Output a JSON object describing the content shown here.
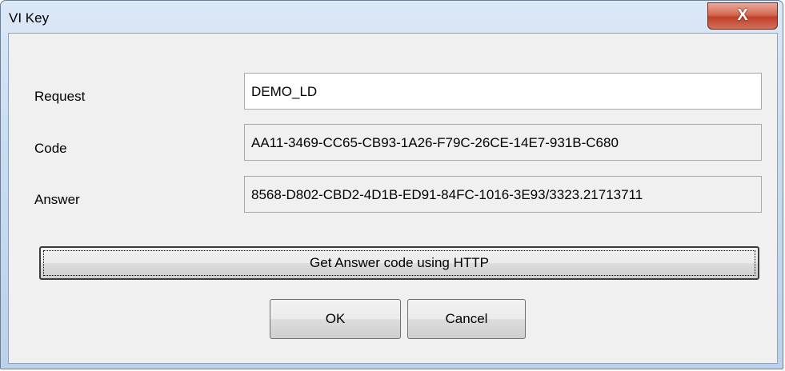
{
  "window": {
    "title": "VI Key",
    "close_glyph": "X"
  },
  "fields": {
    "request": {
      "label": "Request",
      "value": "DEMO_LD"
    },
    "code": {
      "label": "Code",
      "value": "AA11-3469-CC65-CB93-1A26-F79C-26CE-14E7-931B-C680"
    },
    "answer": {
      "label": "Answer",
      "value": "8568-D802-CBD2-4D1B-ED91-84FC-1016-3E93/3323.21713711"
    }
  },
  "buttons": {
    "http": "Get Answer code using HTTP",
    "ok": "OK",
    "cancel": "Cancel"
  },
  "colors": {
    "close_button": "#c94a34",
    "title_bar": "#c9dcf1",
    "dialog_face": "#f0f0f0"
  }
}
